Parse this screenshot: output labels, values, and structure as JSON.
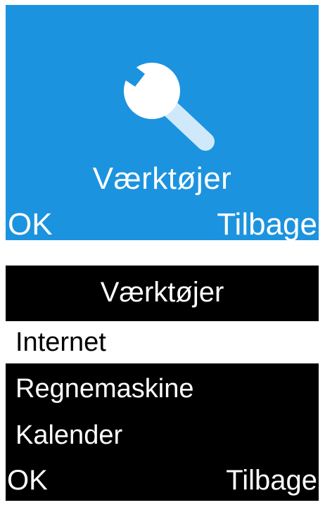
{
  "screen1": {
    "icon": "wrench-icon",
    "title": "Værktøjer",
    "softkey_left": "OK",
    "softkey_right": "Tilbage",
    "background_color": "#1c93df"
  },
  "screen2": {
    "title": "Værktøjer",
    "items": [
      {
        "label": "Internet",
        "selected": true
      },
      {
        "label": "Regnemaskine",
        "selected": false
      },
      {
        "label": "Kalender",
        "selected": false
      }
    ],
    "softkey_left": "OK",
    "softkey_right": "Tilbage"
  }
}
